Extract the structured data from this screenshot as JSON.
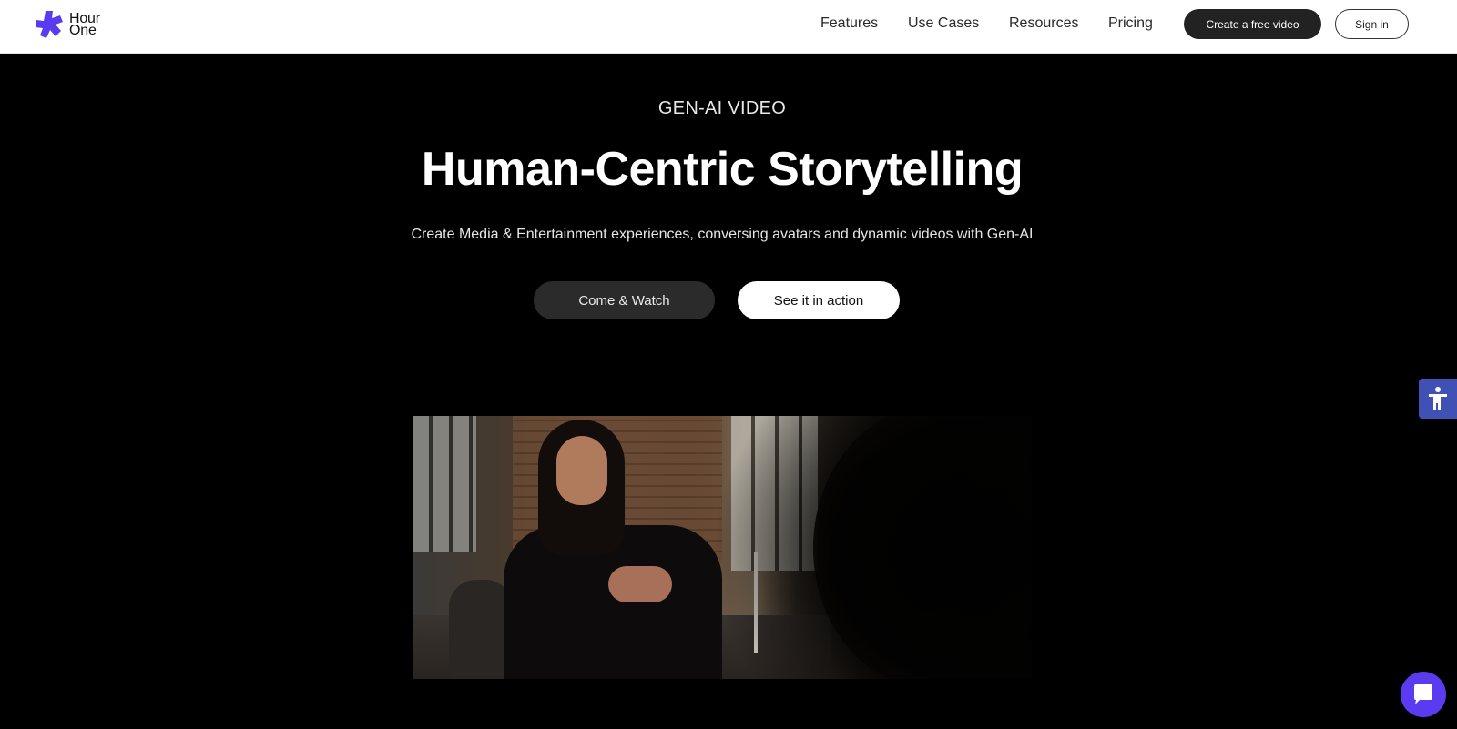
{
  "header": {
    "logo_line1": "Hour",
    "logo_line2": "One",
    "nav": [
      "Features",
      "Use Cases",
      "Resources",
      "Pricing"
    ],
    "cta_label": "Create a free video",
    "signin_label": "Sign in"
  },
  "hero": {
    "eyebrow": "GEN-AI VIDEO",
    "headline": "Human-Centric Storytelling",
    "subline": "Create Media & Entertainment experiences, conversing avatars and dynamic videos with Gen-AI",
    "watch_label": "Come & Watch",
    "action_label": "See it in action"
  },
  "colors": {
    "brand": "#5b3bf0",
    "accessibility": "#3f51b5",
    "background": "#000000",
    "cta_dark": "#222222"
  },
  "icons": {
    "logo": "hour-one-logo-icon",
    "accessibility": "accessibility-icon",
    "chat": "chat-icon"
  }
}
